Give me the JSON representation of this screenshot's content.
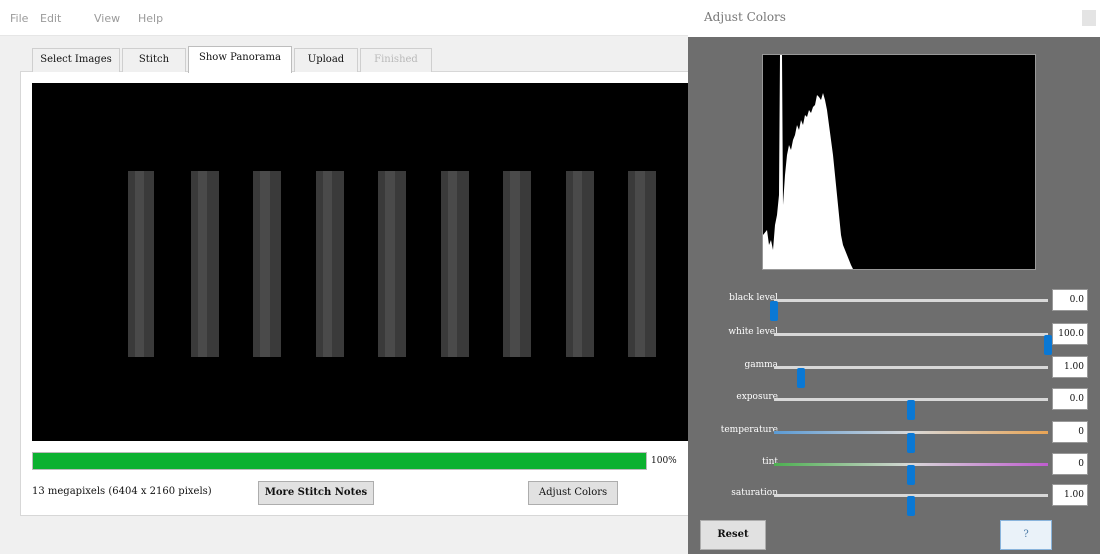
{
  "menu": [
    "File",
    "Edit",
    "View",
    "Help"
  ],
  "tabs": [
    {
      "label": "Select Images",
      "state": "normal"
    },
    {
      "label": "Stitch",
      "state": "normal"
    },
    {
      "label": "Show Panorama",
      "state": "active"
    },
    {
      "label": "Upload",
      "state": "normal"
    },
    {
      "label": "Finished",
      "state": "disabled"
    }
  ],
  "preview": {
    "strip_count": 9
  },
  "progress": {
    "value": 100,
    "text": "100%"
  },
  "info_text": "13 megapixels (6404 x 2160 pixels)",
  "buttons": {
    "notes": "More Stitch Notes",
    "adjust": "Adjust Colors"
  },
  "dialog": {
    "title": "Adjust Colors",
    "reset": "Reset",
    "help": "?",
    "sliders": [
      {
        "label": "black level",
        "value": "0.0",
        "level": 0.0,
        "track": "plain"
      },
      {
        "label": "white level",
        "value": "100.0",
        "level": 1.0,
        "track": "plain"
      },
      {
        "label": "gamma",
        "value": "1.00",
        "level": 0.1,
        "track": "plain"
      },
      {
        "label": "exposure",
        "value": "0.0",
        "level": 0.5,
        "track": "plain"
      },
      {
        "label": "temperature",
        "value": "0",
        "level": 0.5,
        "track": "temperature"
      },
      {
        "label": "tint",
        "value": "0",
        "level": 0.5,
        "track": "tint"
      },
      {
        "label": "saturation",
        "value": "1.00",
        "level": 0.5,
        "track": "plain"
      }
    ]
  },
  "colors": {
    "progress": "#0cb130",
    "slider_handle": "#0a78d4",
    "dialog_bg": "#6e6e6e"
  }
}
